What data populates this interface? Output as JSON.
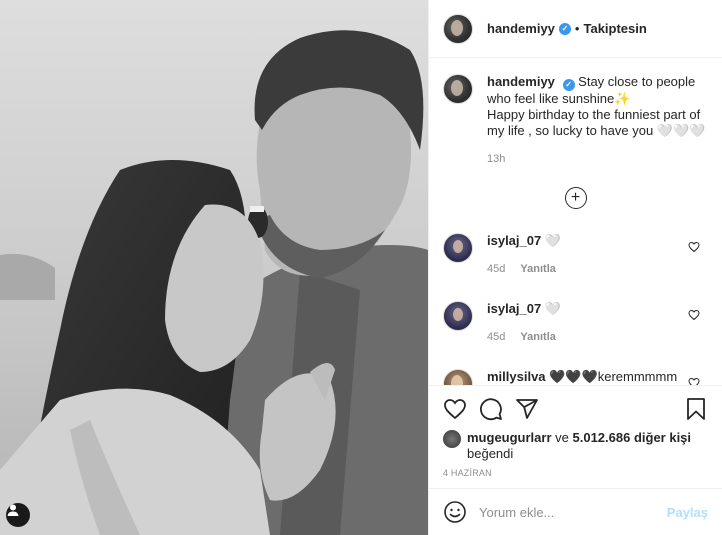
{
  "post": {
    "image_alt": "",
    "username": "handemiyy",
    "verified": true,
    "follow_status": "Takiptesin",
    "separator": "•"
  },
  "caption": {
    "username": "handemiyy",
    "text_line1": "Stay close to people who feel like sunshine✨",
    "text_line2": "Happy birthday to the funniest part of my life , so lucky to have you 🤍🤍🤍",
    "time": "13h"
  },
  "comments": [
    {
      "username": "isylaj_07",
      "text": "🤍",
      "age": "45d",
      "reply_label": "Yanıtla"
    },
    {
      "username": "isylaj_07",
      "text": "🤍",
      "age": "45d",
      "reply_label": "Yanıtla"
    },
    {
      "username": "millysilva",
      "text": "🖤🖤🖤keremmmmm🖤🖤"
    }
  ],
  "likes": {
    "first_user": "mugeugurlarr",
    "connector": "ve",
    "count_text": "5.012.686 diğer kişi",
    "suffix": "beğendi"
  },
  "date": "4 HAZİRAN",
  "add_comment": {
    "placeholder": "Yorum ekle...",
    "post_label": "Paylaş"
  },
  "icons": {
    "like": "heart-icon",
    "comment": "comment-icon",
    "share": "share-icon",
    "save": "bookmark-icon",
    "emoji": "emoji-icon",
    "load_more": "plus-circle-icon",
    "user_tags": "user-tag-icon"
  },
  "colors": {
    "verified": "#3897f0",
    "post_button_disabled": "#b2dffc",
    "muted_text": "#8e8e8e"
  }
}
